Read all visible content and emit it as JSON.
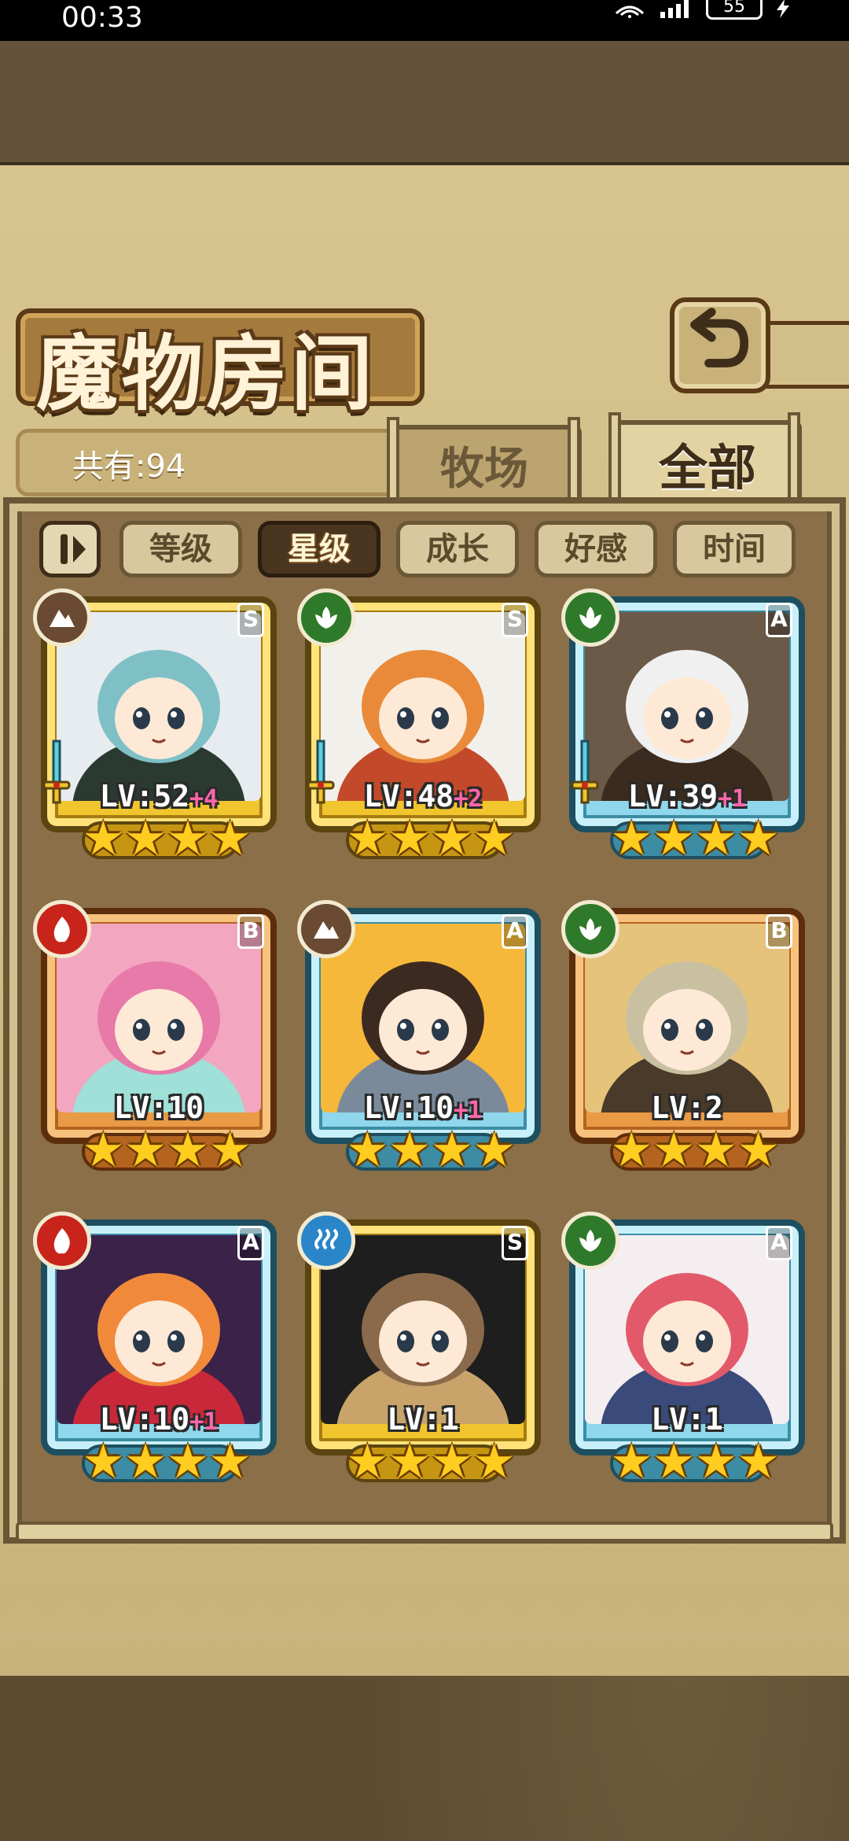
{
  "status_bar": {
    "time": "00:33",
    "battery": "55",
    "icons": [
      "wifi-icon",
      "signal-icon",
      "battery-icon",
      "charging-icon"
    ]
  },
  "header": {
    "title": "魔物房间",
    "back_icon": "back-arrow-icon"
  },
  "summary": {
    "count_label": "共有:94"
  },
  "tabs": [
    {
      "label": "牧场",
      "active": false
    },
    {
      "label": "全部",
      "active": true
    }
  ],
  "sort_filters": {
    "pause_icon": "pause-icon",
    "buttons": [
      {
        "label": "等级",
        "active": false
      },
      {
        "label": "星级",
        "active": true
      },
      {
        "label": "成长",
        "active": false
      },
      {
        "label": "好感",
        "active": false
      },
      {
        "label": "时间",
        "active": false
      }
    ]
  },
  "monsters": [
    {
      "level_text": "LV:52",
      "bonus": "+4",
      "rank": "S",
      "element": "earth",
      "element_icon": "mountain-icon",
      "frame_color": "gold",
      "stars": 4,
      "has_weapon": true,
      "portrait_colors": [
        "#e6ecef",
        "#7fc0c6",
        "#2a3a30"
      ]
    },
    {
      "level_text": "LV:48",
      "bonus": "+2",
      "rank": "S",
      "element": "nature",
      "element_icon": "leaf-icon",
      "frame_color": "gold",
      "stars": 4,
      "has_weapon": true,
      "portrait_colors": [
        "#f2f0ea",
        "#e98a3a",
        "#c24a2a"
      ]
    },
    {
      "level_text": "LV:39",
      "bonus": "+1",
      "rank": "A",
      "element": "nature",
      "element_icon": "leaf-icon",
      "frame_color": "blue",
      "stars": 4,
      "has_weapon": true,
      "portrait_colors": [
        "#6b5a48",
        "#f0f0f0",
        "#3b2b1e"
      ]
    },
    {
      "level_text": "LV:10",
      "bonus": "",
      "rank": "B",
      "element": "fire",
      "element_icon": "flame-icon",
      "frame_color": "orange",
      "stars": 4,
      "has_weapon": false,
      "portrait_colors": [
        "#f2a6c0",
        "#e77aa8",
        "#9fe0d8"
      ]
    },
    {
      "level_text": "LV:10",
      "bonus": "+1",
      "rank": "A",
      "element": "earth",
      "element_icon": "mountain-icon",
      "frame_color": "blue",
      "stars": 4,
      "has_weapon": false,
      "portrait_colors": [
        "#f5b83a",
        "#3c2a20",
        "#7a8a9a"
      ]
    },
    {
      "level_text": "LV:2",
      "bonus": "",
      "rank": "B",
      "element": "nature",
      "element_icon": "leaf-icon",
      "frame_color": "orange",
      "stars": 4,
      "has_weapon": false,
      "portrait_colors": [
        "#e6c37a",
        "#c9c0a2",
        "#4a3a2a"
      ]
    },
    {
      "level_text": "LV:10",
      "bonus": "+1",
      "rank": "A",
      "element": "fire",
      "element_icon": "flame-icon",
      "frame_color": "blue",
      "stars": 4,
      "has_weapon": false,
      "portrait_colors": [
        "#3a2248",
        "#f08a3a",
        "#c8283a"
      ]
    },
    {
      "level_text": "LV:1",
      "bonus": "",
      "rank": "S",
      "element": "water",
      "element_icon": "wave-icon",
      "frame_color": "gold",
      "stars": 4,
      "has_weapon": false,
      "portrait_colors": [
        "#1e1e1e",
        "#8a6a4a",
        "#c9a46a"
      ]
    },
    {
      "level_text": "LV:1",
      "bonus": "",
      "rank": "A",
      "element": "nature",
      "element_icon": "leaf-icon",
      "frame_color": "blue",
      "stars": 4,
      "has_weapon": false,
      "portrait_colors": [
        "#f4eef0",
        "#e25a6a",
        "#3a4a7a"
      ]
    }
  ]
}
